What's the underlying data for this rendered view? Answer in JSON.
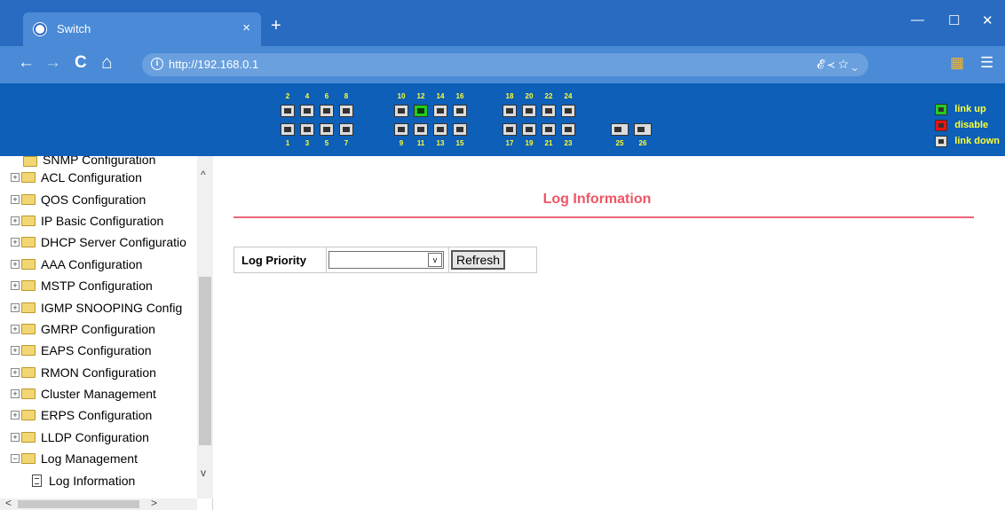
{
  "browser": {
    "tab_title": "Switch",
    "close_glyph": "×",
    "new_tab_glyph": "+",
    "window_buttons": [
      "—",
      "☐",
      "✕"
    ],
    "url": "http://192.168.0.1",
    "info_glyph": "i",
    "back_glyph": "←",
    "forward_glyph": "→",
    "reload_glyph": "C",
    "home_glyph": "⌂",
    "url_right_icons": "𝓔  ≺  ☆  ⌄",
    "apps_glyph": "▦",
    "menu_glyph": "☰"
  },
  "banner": {
    "top_numbers": [
      "2",
      "4",
      "6",
      "8",
      "10",
      "12",
      "14",
      "16",
      "18",
      "20",
      "22",
      "24"
    ],
    "bottom_numbers": [
      "1",
      "3",
      "5",
      "7",
      "9",
      "11",
      "13",
      "15",
      "17",
      "19",
      "21",
      "23",
      "25",
      "26"
    ],
    "linked_port": "12",
    "legend": [
      {
        "label": "link up",
        "color": "#22cc22"
      },
      {
        "label": "disable",
        "color": "#ee1111"
      },
      {
        "label": "link down",
        "color": "#dcdcdc"
      }
    ]
  },
  "sidebar": {
    "partial_top_label": "SNMP Configuration",
    "items": [
      {
        "label": "ACL Configuration",
        "toggle": "+"
      },
      {
        "label": "QOS Configuration",
        "toggle": "+"
      },
      {
        "label": "IP Basic Configuration",
        "toggle": "+"
      },
      {
        "label": "DHCP Server Configuratio",
        "toggle": "+"
      },
      {
        "label": "AAA Configuration",
        "toggle": "+"
      },
      {
        "label": "MSTP Configuration",
        "toggle": "+"
      },
      {
        "label": "IGMP SNOOPING Config",
        "toggle": "+"
      },
      {
        "label": "GMRP Configuration",
        "toggle": "+"
      },
      {
        "label": "EAPS Configuration",
        "toggle": "+"
      },
      {
        "label": "RMON Configuration",
        "toggle": "+"
      },
      {
        "label": "Cluster Management",
        "toggle": "+"
      },
      {
        "label": "ERPS Configuration",
        "toggle": "+"
      },
      {
        "label": "LLDP Configuration",
        "toggle": "+"
      },
      {
        "label": "Log Management",
        "toggle": "−"
      }
    ],
    "child": "Log Information",
    "scroll_up": "^",
    "scroll_down": "v",
    "scroll_left": "<",
    "scroll_right": ">"
  },
  "main": {
    "title": "Log Information",
    "log_priority_label": "Log Priority",
    "log_priority_value": "",
    "select_arrow": "v",
    "refresh_label": "Refresh"
  }
}
